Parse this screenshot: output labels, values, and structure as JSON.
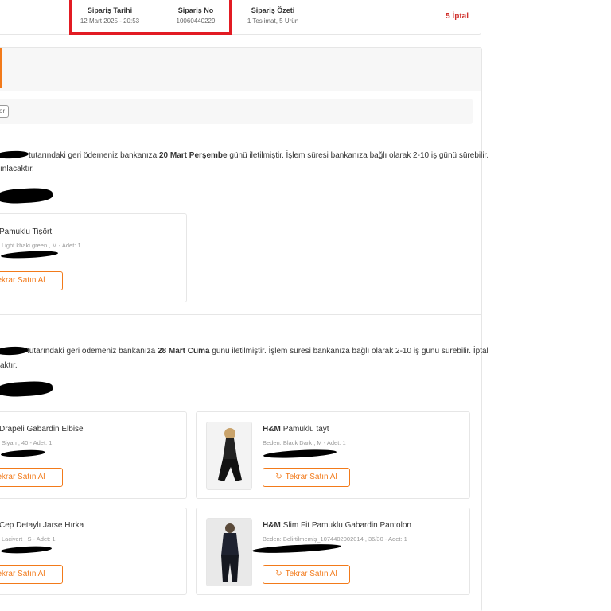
{
  "summary": {
    "order_date_label": "Sipariş Tarihi",
    "order_date_value": "12 Mart 2025 - 20:53",
    "order_no_label": "Sipariş No",
    "order_no_value": "10060440229",
    "order_summary_label": "Sipariş Özeti",
    "order_summary_value": "1 Teslimat, 5 Ürün",
    "cancel_status": "5 İptal"
  },
  "filter_chip": "or",
  "refund1": {
    "text_before": "tutarındaki geri ödemeniz bankanıza ",
    "date": "20 Mart Perşembe",
    "text_after": " günü iletilmiştir. İşlem süresi bankanıza bağlı olarak 2-10 iş günü sürebilir.",
    "line2": "ınlacaktır."
  },
  "refund2": {
    "text_before": "tutarındaki geri ödemeniz bankanıza ",
    "date": "28 Mart Cuma",
    "text_after": " günü iletilmiştir. İşlem süresi bankanıza bağlı olarak 2-10 iş günü sürebilir. İptal",
    "line2": "aktır."
  },
  "rebuy_label": "Tekrar Satın Al",
  "products": [
    {
      "name": "Pamuklu Tişört",
      "meta": "Light khaki green , M - Adet: 1"
    },
    {
      "name": "Drapeli Gabardin Elbise",
      "meta": "Siyah , 40 - Adet: 1"
    },
    {
      "brand": "H&M",
      "name": "Pamuklu tayt",
      "meta": "Beden: Black Dark , M - Adet: 1"
    },
    {
      "name": "Cep Detaylı Jarse Hırka",
      "meta": "Lacivert , S - Adet: 1"
    },
    {
      "brand": "H&M",
      "name": "Slim Fit Pamuklu Gabardin Pantolon",
      "meta": "Beden: Belirtilmemiş_1074402002014 , 36/30 - Adet: 1"
    }
  ],
  "colors": {
    "accent": "#f27a1a",
    "cancel": "#d0312d",
    "highlight": "#e21b23"
  },
  "icons": {
    "rebuy": "refresh-icon"
  }
}
